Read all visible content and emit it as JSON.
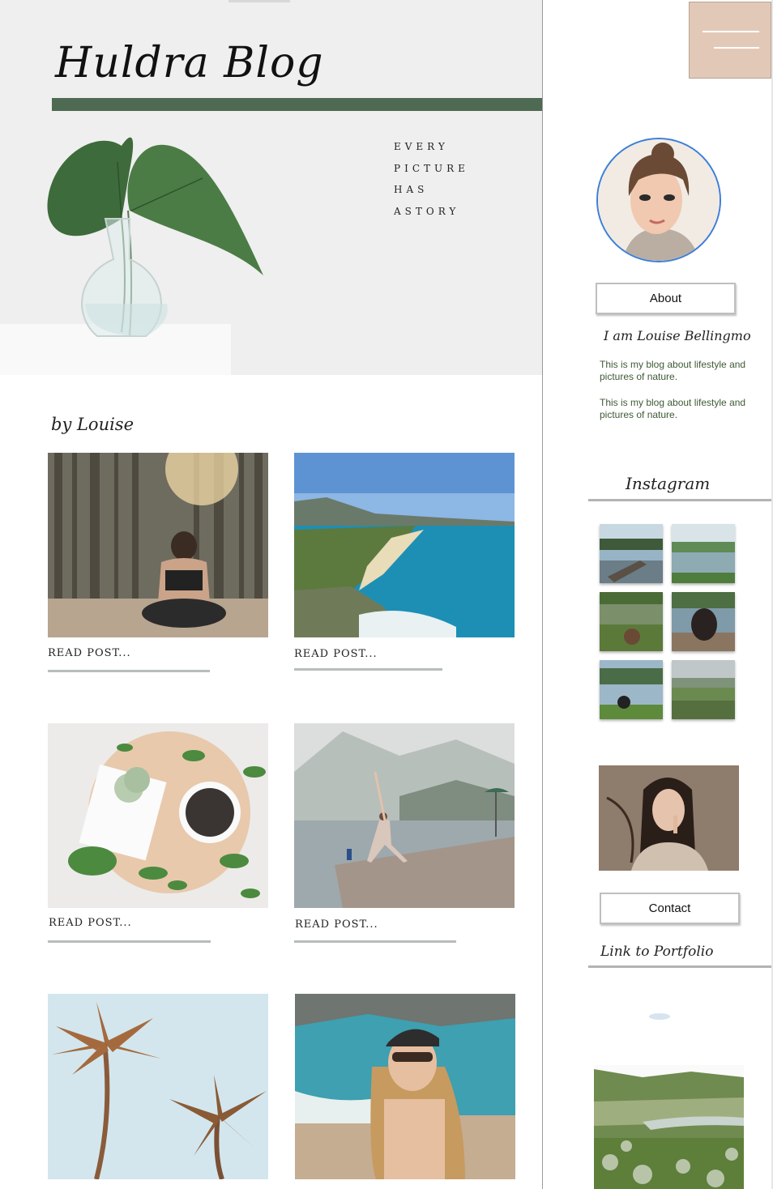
{
  "blog": {
    "title": "Huldra Blog",
    "tagline": [
      "EVERY",
      "PICTURE",
      "HAS",
      "ASTORY"
    ],
    "byline": "by Louise"
  },
  "posts": [
    {
      "read_label": "READ POST...",
      "image": "forest-meditation-photo"
    },
    {
      "read_label": "READ POST...",
      "image": "coastline-beach-photo"
    },
    {
      "read_label": "READ POST...",
      "image": "coffee-flatlay-photo"
    },
    {
      "read_label": "READ POST...",
      "image": "lake-yoga-photo"
    },
    {
      "read_label": "",
      "image": "palm-trees-photo"
    },
    {
      "read_label": "",
      "image": "beach-portrait-photo"
    }
  ],
  "sidebar": {
    "menu_icon": "hamburger-menu-icon",
    "about_label": "About",
    "intro": "I am Louise Bellingmo",
    "bio_1": "This is my blog about lifestyle and pictures of nature.",
    "bio_2": "This is my blog about lifestyle and pictures of nature.",
    "instagram_title": "Instagram",
    "instagram_thumbs": [
      "lake-dock-1",
      "lake-forest-2",
      "lake-shore-3",
      "dog-on-dock-4",
      "dog-by-lake-5",
      "meadow-6"
    ],
    "contact_label": "Contact",
    "portfolio_title": "Link to Portfolio"
  },
  "colors": {
    "accent_green": "#4f6a52",
    "menu_bg": "#e2c9b7",
    "bio_text": "#3f5a35",
    "avatar_ring": "#3c7fd9"
  }
}
